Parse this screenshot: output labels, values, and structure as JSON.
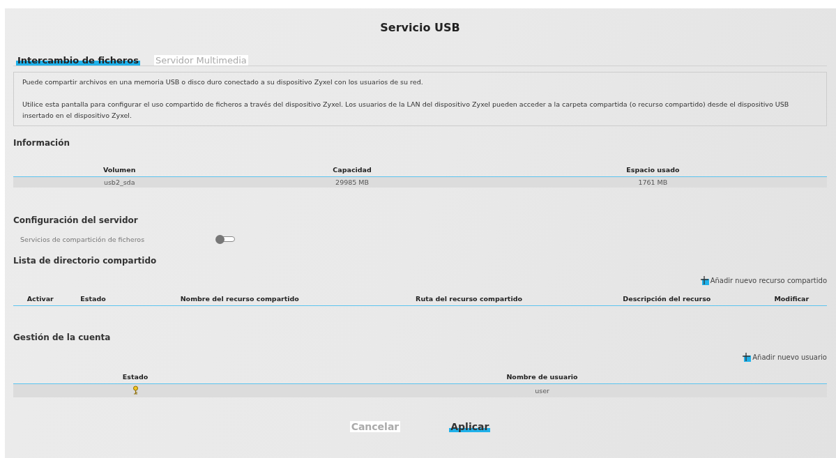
{
  "title": "Servicio USB",
  "tabs": [
    {
      "label": "Intercambio de ficheros",
      "selected": true
    },
    {
      "label": "Servidor Multimedia",
      "selected": false
    }
  ],
  "description": [
    "Puede compartir archivos en una memoria USB o disco duro conectado a su dispositivo Zyxel con los usuarios de su red.",
    "Utilice esta pantalla para configurar el uso compartido de ficheros a través del dispositivo Zyxel. Los usuarios de la LAN del dispositivo Zyxel pueden acceder a la carpeta compartida (o recurso compartido) desde el dispositivo USB insertado en el dispositivo Zyxel."
  ],
  "information": {
    "heading": "Información",
    "columns": [
      "Volumen",
      "Capacidad",
      "Espacio usado"
    ],
    "rows": [
      [
        "usb2_sda",
        "29985 MB",
        "1761 MB"
      ]
    ]
  },
  "server_config": {
    "heading": "Configuración del servidor",
    "settings": [
      {
        "label": "Servicios de compartición de ficheros",
        "on": false
      }
    ]
  },
  "share_list": {
    "heading": "Lista de directorio compartido",
    "add_label": "Añadir nuevo recurso compartido",
    "columns": [
      "Activar",
      "Estado",
      "Nombre del recurso compartido",
      "Ruta del recurso compartido",
      "Descripción del recurso",
      "Modificar"
    ]
  },
  "accounts": {
    "heading": "Gestión de la cuenta",
    "add_label": "Añadir nuevo usuario",
    "columns": [
      "Estado",
      "Nombre de usuario"
    ],
    "rows": [
      {
        "active": true,
        "name": "user"
      }
    ]
  },
  "buttons": [
    {
      "label": "Cancelar",
      "kind": "secondary"
    },
    {
      "label": "Aplicar",
      "kind": "primary"
    }
  ]
}
